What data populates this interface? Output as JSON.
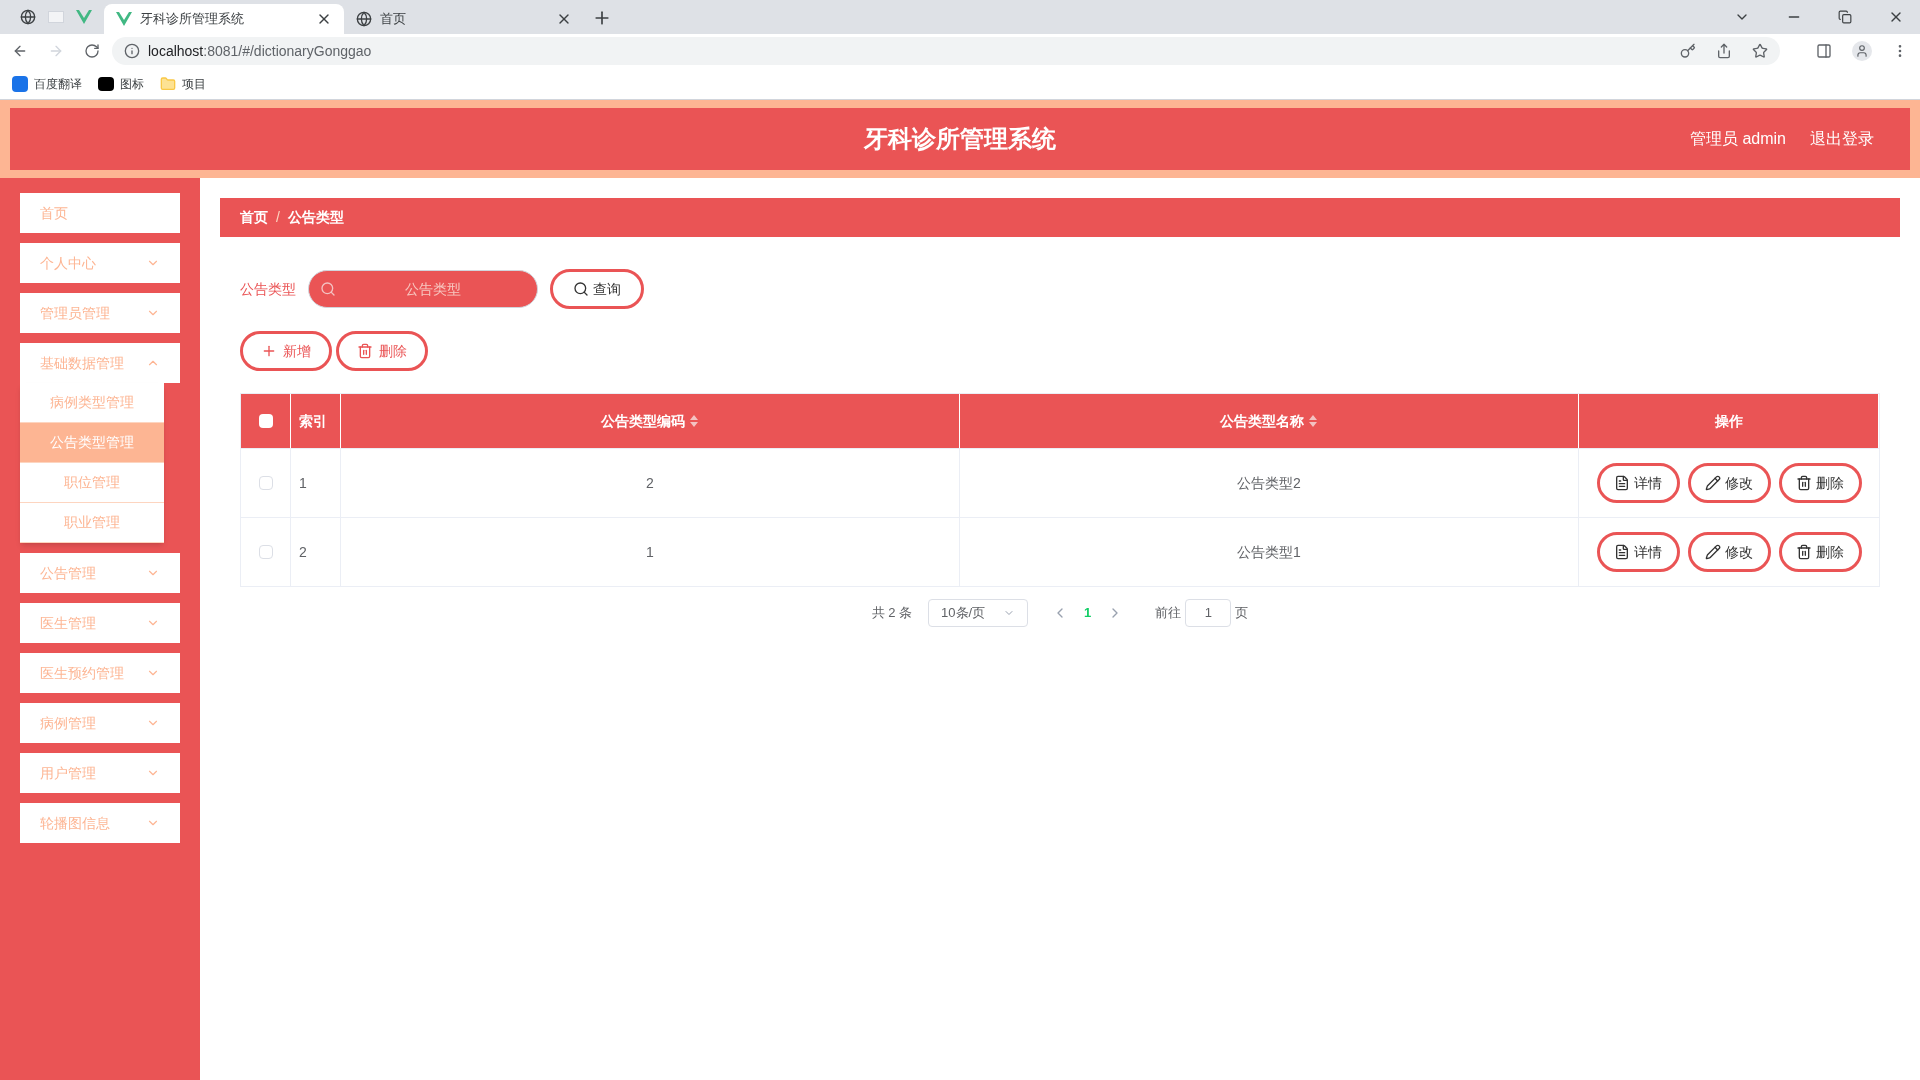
{
  "browser": {
    "tabs": [
      {
        "title": "牙科诊所管理系统",
        "selected": true
      },
      {
        "title": "首页",
        "selected": false
      }
    ],
    "url_host": "localhost",
    "url_path": ":8081/#/dictionaryGonggao",
    "bookmarks": [
      "百度翻译",
      "图标",
      "项目"
    ]
  },
  "header": {
    "title": "牙科诊所管理系统",
    "user": "管理员 admin",
    "logout": "退出登录"
  },
  "sidebar": {
    "items": [
      {
        "label": "首页",
        "kind": "link"
      },
      {
        "label": "个人中心",
        "kind": "menu",
        "expanded": false
      },
      {
        "label": "管理员管理",
        "kind": "menu",
        "expanded": false
      },
      {
        "label": "基础数据管理",
        "kind": "menu",
        "expanded": true,
        "children": [
          {
            "label": "病例类型管理",
            "selected": false
          },
          {
            "label": "公告类型管理",
            "selected": true
          },
          {
            "label": "职位管理",
            "selected": false
          },
          {
            "label": "职业管理",
            "selected": false
          }
        ]
      },
      {
        "label": "公告管理",
        "kind": "menu",
        "expanded": false
      },
      {
        "label": "医生管理",
        "kind": "menu",
        "expanded": false
      },
      {
        "label": "医生预约管理",
        "kind": "menu",
        "expanded": false
      },
      {
        "label": "病例管理",
        "kind": "menu",
        "expanded": false
      },
      {
        "label": "用户管理",
        "kind": "menu",
        "expanded": false
      },
      {
        "label": "轮播图信息",
        "kind": "menu",
        "expanded": false
      }
    ]
  },
  "breadcrumb": [
    "首页",
    "公告类型"
  ],
  "breadcrumb_separator": "/",
  "search": {
    "label": "公告类型",
    "placeholder": "公告类型",
    "button": "查询"
  },
  "actions": [
    {
      "label": "新增",
      "kind": "add"
    },
    {
      "label": "删除",
      "kind": "delete"
    }
  ],
  "table": {
    "all_checked": false,
    "columns": [
      {
        "label": "索引",
        "sortable": false
      },
      {
        "label": "公告类型编码",
        "sortable": true
      },
      {
        "label": "公告类型名称",
        "sortable": true
      },
      {
        "label": "操作",
        "sortable": false
      }
    ],
    "rows": [
      {
        "checked": false,
        "cells": [
          "1",
          "2",
          "公告类型2"
        ],
        "actions": [
          {
            "label": "详情",
            "kind": "detail"
          },
          {
            "label": "修改",
            "kind": "edit"
          },
          {
            "label": "删除",
            "kind": "delete"
          }
        ]
      },
      {
        "checked": false,
        "cells": [
          "2",
          "1",
          "公告类型1"
        ],
        "actions": [
          {
            "label": "详情",
            "kind": "detail"
          },
          {
            "label": "修改",
            "kind": "edit"
          },
          {
            "label": "删除",
            "kind": "delete"
          }
        ]
      }
    ]
  },
  "pagination": {
    "total": "共 2 条",
    "page_size": "10条/页",
    "pages": [
      {
        "label": "1",
        "selected": true
      }
    ],
    "goto_label": "前往",
    "goto_value": "1",
    "goto_suffix": "页"
  }
}
